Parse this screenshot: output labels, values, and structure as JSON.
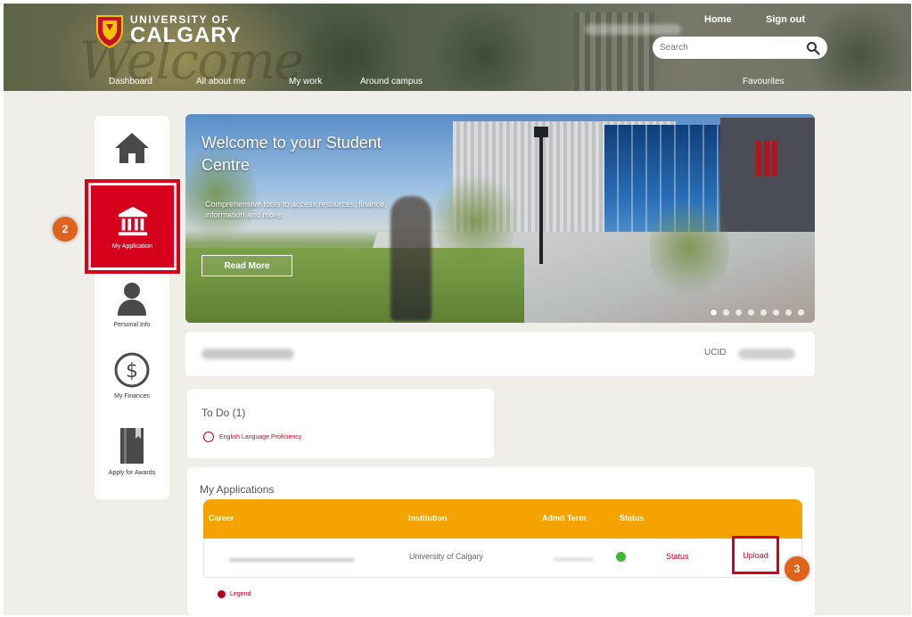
{
  "header": {
    "logo": {
      "line1": "UNIVERSITY OF",
      "line2": "CALGARY"
    },
    "top_links": {
      "home": "Home",
      "sign_out": "Sign out"
    },
    "search": {
      "placeholder": "Search"
    },
    "nav": {
      "dashboard": "Dashboard",
      "all_about_me": "All about me",
      "my_work": "My work",
      "around_campus": "Around campus",
      "favourites": "Favourites"
    },
    "background_text": "Welcome"
  },
  "sidebar": {
    "items": [
      {
        "icon": "home-icon",
        "label": ""
      },
      {
        "icon": "institution-icon",
        "label": "My Application"
      },
      {
        "icon": "person-icon",
        "label": "Personal Info"
      },
      {
        "icon": "dollar-circle-icon",
        "label": "My Finances"
      },
      {
        "icon": "book-icon",
        "label": "Apply for Awards"
      }
    ]
  },
  "steps": {
    "step2": "2",
    "step3": "3"
  },
  "hero": {
    "title": "Welcome to your Student Centre",
    "subtitle": "Comprehensive tools to access resources, finance, information and more.",
    "button": "Read More",
    "slide_count": 8,
    "active_slide": 1
  },
  "profile": {
    "ucid_label": "UCID"
  },
  "todo": {
    "title": "To Do (1)",
    "items": [
      "English Language Proficiency"
    ]
  },
  "applications": {
    "title": "My Applications",
    "columns": [
      "Career",
      "Institution",
      "Admit Term",
      "Status"
    ],
    "rows": [
      {
        "institution": "University of Calgary",
        "status_link": "Status",
        "upload": "Upload"
      }
    ],
    "legend": "Legend"
  },
  "colors": {
    "brand_red": "#d6001c",
    "table_header": "#f5a300",
    "step_badge": "#e0631c",
    "status_ok": "#3fba35"
  }
}
